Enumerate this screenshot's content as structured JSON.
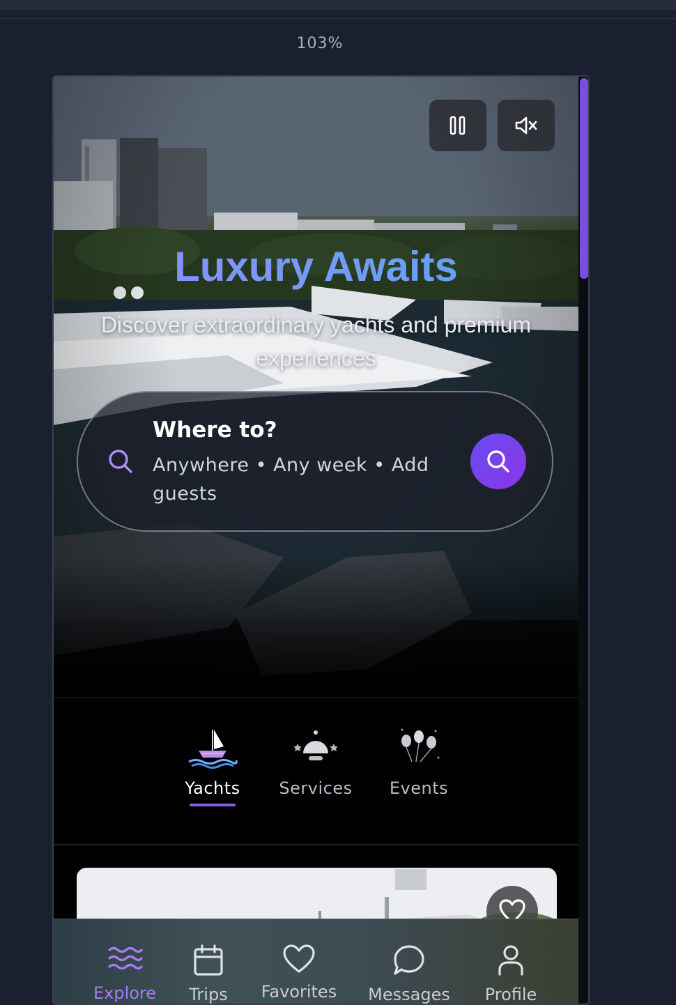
{
  "browser": {
    "zoom": "103%"
  },
  "hero": {
    "title": "Luxury Awaits",
    "subtitle": "Discover extraordinary yachts and premium experiences",
    "controls": {
      "pause_icon": "pause-icon",
      "mute_icon": "volume-muted-icon"
    }
  },
  "search": {
    "title": "Where to?",
    "summary": "Anywhere • Any week • Add guests",
    "icon": "search-icon"
  },
  "categories": [
    {
      "label": "Yachts",
      "icon": "sailboat-icon",
      "active": true
    },
    {
      "label": "Services",
      "icon": "concierge-bell-icon",
      "active": false
    },
    {
      "label": "Events",
      "icon": "balloons-icon",
      "active": false
    }
  ],
  "listing": {
    "favorite_icon": "heart-icon"
  },
  "tabbar": [
    {
      "label": "Explore",
      "icon": "waves-icon",
      "active": true
    },
    {
      "label": "Trips",
      "icon": "calendar-icon",
      "active": false
    },
    {
      "label": "Favorites",
      "icon": "heart-icon",
      "active": false
    },
    {
      "label": "Messages",
      "icon": "chat-bubble-icon",
      "active": false
    },
    {
      "label": "Profile",
      "icon": "user-icon",
      "active": false
    }
  ],
  "colors": {
    "accent": "#8a5cf0",
    "search_button": "#6a4cf0",
    "title_gradient_start": "#8f8ef7",
    "title_gradient_end": "#58a8f6"
  }
}
